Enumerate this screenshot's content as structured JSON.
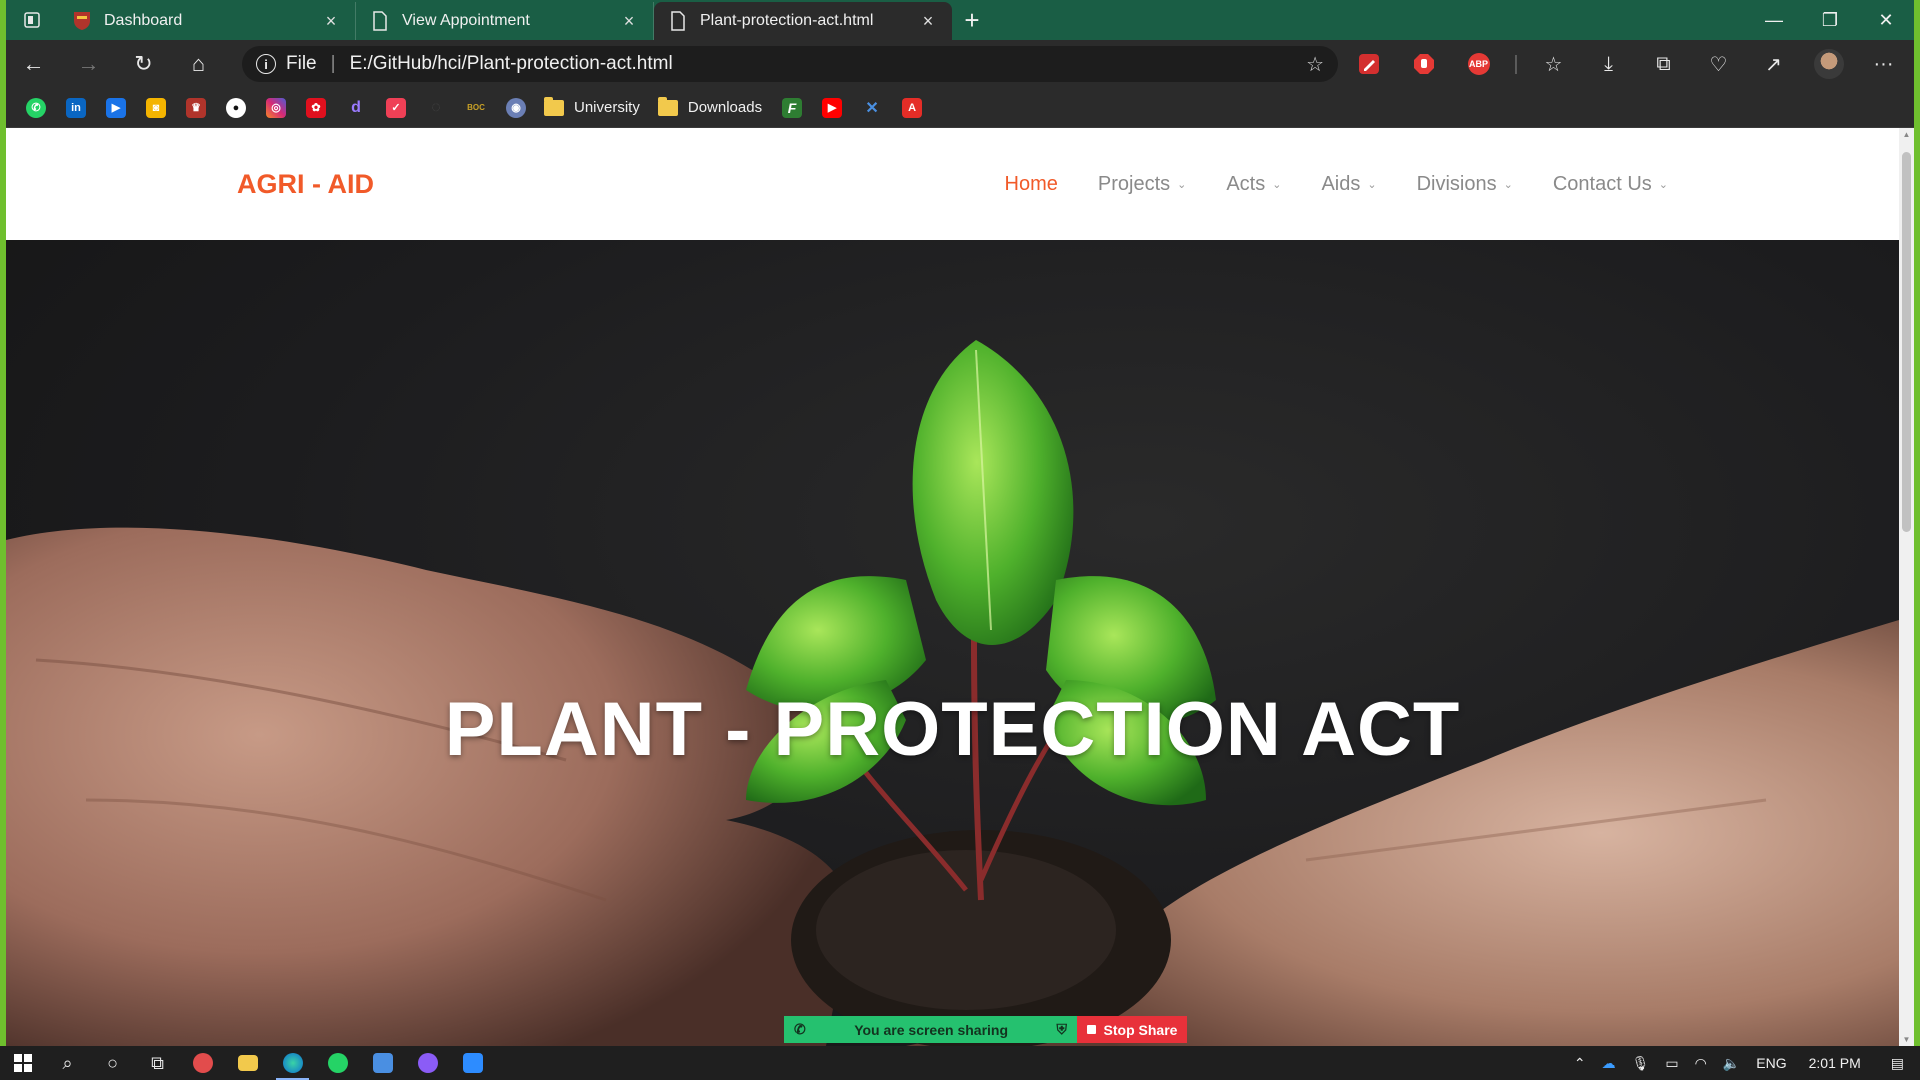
{
  "browser": {
    "tabs": [
      {
        "title": "Dashboard",
        "close": "×"
      },
      {
        "title": "View Appointment",
        "close": "×"
      },
      {
        "title": "Plant-protection-act.html",
        "close": "×"
      }
    ],
    "new_tab": "+",
    "window_controls": {
      "minimize": "—",
      "restore": "❐",
      "close": "✕"
    },
    "nav": {
      "back": "←",
      "forward": "→",
      "refresh": "↻",
      "home": "⌂"
    },
    "address": {
      "scheme_label": "File",
      "url": "E:/GitHub/hci/Plant-protection-act.html",
      "info": "i"
    },
    "extensions": [
      {
        "name": "pen-extension-icon",
        "label": ""
      },
      {
        "name": "stop-extension-icon",
        "label": ""
      },
      {
        "name": "adblock-icon",
        "label": "ABP"
      },
      {
        "name": "favorites-icon",
        "label": "☆"
      },
      {
        "name": "downloads-icon",
        "label": "⤓"
      },
      {
        "name": "collections-icon",
        "label": "⧉"
      },
      {
        "name": "performance-icon",
        "label": "♡"
      },
      {
        "name": "share-icon",
        "label": "↗"
      },
      {
        "name": "profile-avatar",
        "label": ""
      },
      {
        "name": "more-menu-icon",
        "label": "···"
      }
    ],
    "bookmarks": {
      "icons": [
        {
          "name": "whatsapp-icon",
          "color": "#25d366",
          "glyph": "✆"
        },
        {
          "name": "linkedin-icon",
          "color": "#0a66c2",
          "glyph": "in"
        },
        {
          "name": "video-app-icon",
          "color": "#1a73e8",
          "glyph": "▶"
        },
        {
          "name": "camera-app-icon",
          "color": "#f4b400",
          "glyph": "◙"
        },
        {
          "name": "university-crest-icon",
          "color": "#b0342b",
          "glyph": "♛"
        },
        {
          "name": "github-icon",
          "color": "#333333",
          "glyph": "●"
        },
        {
          "name": "instagram-icon",
          "color": "#d62976",
          "glyph": "◎"
        },
        {
          "name": "huawei-icon",
          "color": "#e0101e",
          "glyph": "✿"
        },
        {
          "name": "d-app-icon",
          "color": "#7b61ff",
          "glyph": "d"
        },
        {
          "name": "pocket-icon",
          "color": "#ef4056",
          "glyph": "✓"
        },
        {
          "name": "circle-app-icon",
          "color": "#3a3a3a",
          "glyph": "◌"
        },
        {
          "name": "boc-icon",
          "color": "#2b2b2b",
          "glyph": "BOC"
        },
        {
          "name": "globe-app-icon",
          "color": "#6b7fb5",
          "glyph": "◉"
        }
      ],
      "folders": [
        {
          "label": "University"
        },
        {
          "label": "Downloads"
        }
      ],
      "trailing_icons": [
        {
          "name": "f-app-icon",
          "color": "#2e7d32",
          "glyph": "F"
        },
        {
          "name": "youtube-icon",
          "color": "#ff0000",
          "glyph": "▶"
        },
        {
          "name": "x-app-icon",
          "color": "#2a6fd6",
          "glyph": "✕"
        },
        {
          "name": "adobe-icon",
          "color": "#e52d27",
          "glyph": "A"
        }
      ]
    }
  },
  "site": {
    "brand": "AGRI - AID",
    "menu": [
      {
        "label": "Home",
        "dropdown": false
      },
      {
        "label": "Projects",
        "dropdown": true
      },
      {
        "label": "Acts",
        "dropdown": true
      },
      {
        "label": "Aids",
        "dropdown": true
      },
      {
        "label": "Divisions",
        "dropdown": true
      },
      {
        "label": "Contact Us",
        "dropdown": true
      }
    ],
    "hero_title": "PLANT - PROTECTION ACT"
  },
  "screen_share": {
    "message": "You are screen sharing",
    "stop_label": "Stop Share"
  },
  "taskbar": {
    "tray": {
      "language": "ENG",
      "time": "2:01 PM"
    }
  },
  "colors": {
    "brand": "#f15a29",
    "tab_bar": "#1a5e45",
    "share_green": "#25c16f",
    "share_red": "#e8313a"
  }
}
